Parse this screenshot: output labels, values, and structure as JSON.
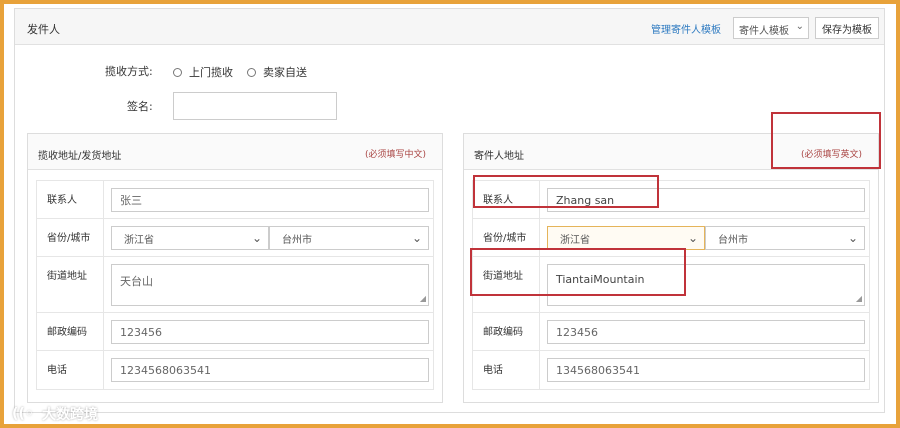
{
  "sender": {
    "title": "发件人",
    "manage_link": "管理寄件人模板",
    "template_select": "寄件人模板",
    "save_template": "保存为模板"
  },
  "pickup": {
    "label": "揽收方式:",
    "options": [
      "上门揽收",
      "卖家自送"
    ]
  },
  "signature": {
    "label": "签名:",
    "value": ""
  },
  "left_card": {
    "title": "揽收地址/发货地址",
    "note": "(必须填写中文)",
    "fields": {
      "contact_label": "联系人",
      "contact_value": "张三",
      "province_label": "省份/城市",
      "province_value": "浙江省",
      "city_value": "台州市",
      "street_label": "街道地址",
      "street_value": "天台山",
      "zip_label": "邮政编码",
      "zip_value": "123456",
      "phone_label": "电话",
      "phone_value": "1234568063541"
    }
  },
  "right_card": {
    "title": "寄件人地址",
    "note": "(必须填写英文)",
    "fields": {
      "contact_label": "联系人",
      "contact_value": "Zhang san",
      "province_label": "省份/城市",
      "province_value": "浙江省",
      "city_value": "台州市",
      "street_label": "街道地址",
      "street_value": "TiantaiMountain",
      "zip_label": "邮政编码",
      "zip_value": "123456",
      "phone_label": "电话",
      "phone_value": "134568063541"
    }
  },
  "watermark": "大数跨境",
  "colors": {
    "frame": "#e8a23a",
    "link": "#2f7bc1",
    "note": "#a94442",
    "highlight_box": "#c0333a"
  },
  "icons": {
    "dropdown": "chevron-down-icon",
    "radio": "radio-icon",
    "watermark": "logo-icon"
  }
}
